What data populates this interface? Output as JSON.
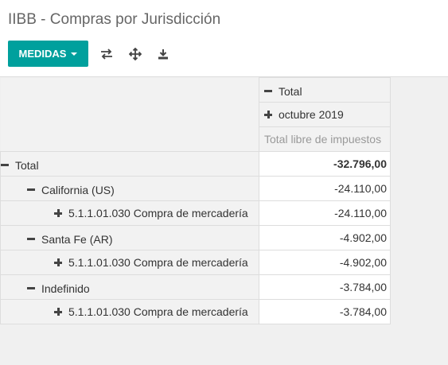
{
  "header": {
    "title": "IIBB - Compras por Jurisdicción",
    "measures_button": "MEDIDAS"
  },
  "toolbar": {
    "icons": [
      "flip-axis-icon",
      "expand-all-icon",
      "download-icon"
    ]
  },
  "pivot": {
    "col_header_total": "Total",
    "col_header_group": "octubre 2019",
    "measure": "Total libre de impuestos",
    "rows": [
      {
        "label": "Total",
        "value": "-32.796,00",
        "level": 0,
        "expanded": true
      },
      {
        "label": "California (US)",
        "value": "-24.110,00",
        "level": 1,
        "expanded": true
      },
      {
        "label": "5.1.1.01.030 Compra de mercadería",
        "value": "-24.110,00",
        "level": 2,
        "expanded": false
      },
      {
        "label": "Santa Fe (AR)",
        "value": "-4.902,00",
        "level": 1,
        "expanded": true
      },
      {
        "label": "5.1.1.01.030 Compra de mercadería",
        "value": "-4.902,00",
        "level": 2,
        "expanded": false
      },
      {
        "label": "Indefinido",
        "value": "-3.784,00",
        "level": 1,
        "expanded": true
      },
      {
        "label": "5.1.1.01.030 Compra de mercadería",
        "value": "-3.784,00",
        "level": 2,
        "expanded": false
      }
    ]
  }
}
